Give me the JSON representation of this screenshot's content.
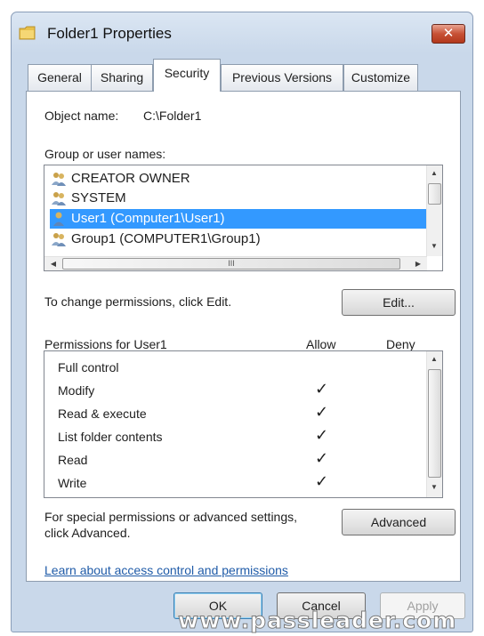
{
  "window": {
    "title": "Folder1 Properties",
    "close_label": "✕"
  },
  "tabs": [
    {
      "label": "General"
    },
    {
      "label": "Sharing"
    },
    {
      "label": "Security",
      "active": true
    },
    {
      "label": "Previous Versions"
    },
    {
      "label": "Customize"
    }
  ],
  "security": {
    "object_label": "Object name:",
    "object_value": "C:\\Folder1",
    "group_label": "Group or user names:",
    "users": [
      {
        "name": "CREATOR OWNER",
        "icon": "group-icon"
      },
      {
        "name": "SYSTEM",
        "icon": "group-icon"
      },
      {
        "name": "User1 (Computer1\\User1)",
        "icon": "user-icon",
        "selected": true
      },
      {
        "name": "Group1 (COMPUTER1\\Group1)",
        "icon": "group-icon"
      }
    ],
    "hscroll_thumb_glyph": "III",
    "change_text": "To change permissions, click Edit.",
    "edit_button": "Edit...",
    "permissions_header": "Permissions for User1",
    "allow_header": "Allow",
    "deny_header": "Deny",
    "permissions": [
      {
        "name": "Full control",
        "allow": "",
        "deny": ""
      },
      {
        "name": "Modify",
        "allow": "✓",
        "deny": ""
      },
      {
        "name": "Read & execute",
        "allow": "✓",
        "deny": ""
      },
      {
        "name": "List folder contents",
        "allow": "✓",
        "deny": ""
      },
      {
        "name": "Read",
        "allow": "✓",
        "deny": ""
      },
      {
        "name": "Write",
        "allow": "✓",
        "deny": ""
      }
    ],
    "special_text_line1": "For special permissions or advanced settings,",
    "special_text_line2": "click Advanced.",
    "advanced_button": "Advanced",
    "learn_link": "Learn about access control and permissions"
  },
  "footer": {
    "ok": "OK",
    "cancel": "Cancel",
    "apply": "Apply"
  },
  "watermark": "www.passleader.com",
  "colors": {
    "selection": "#3399ff",
    "link": "#1f5ba8",
    "close": "#c75135"
  }
}
